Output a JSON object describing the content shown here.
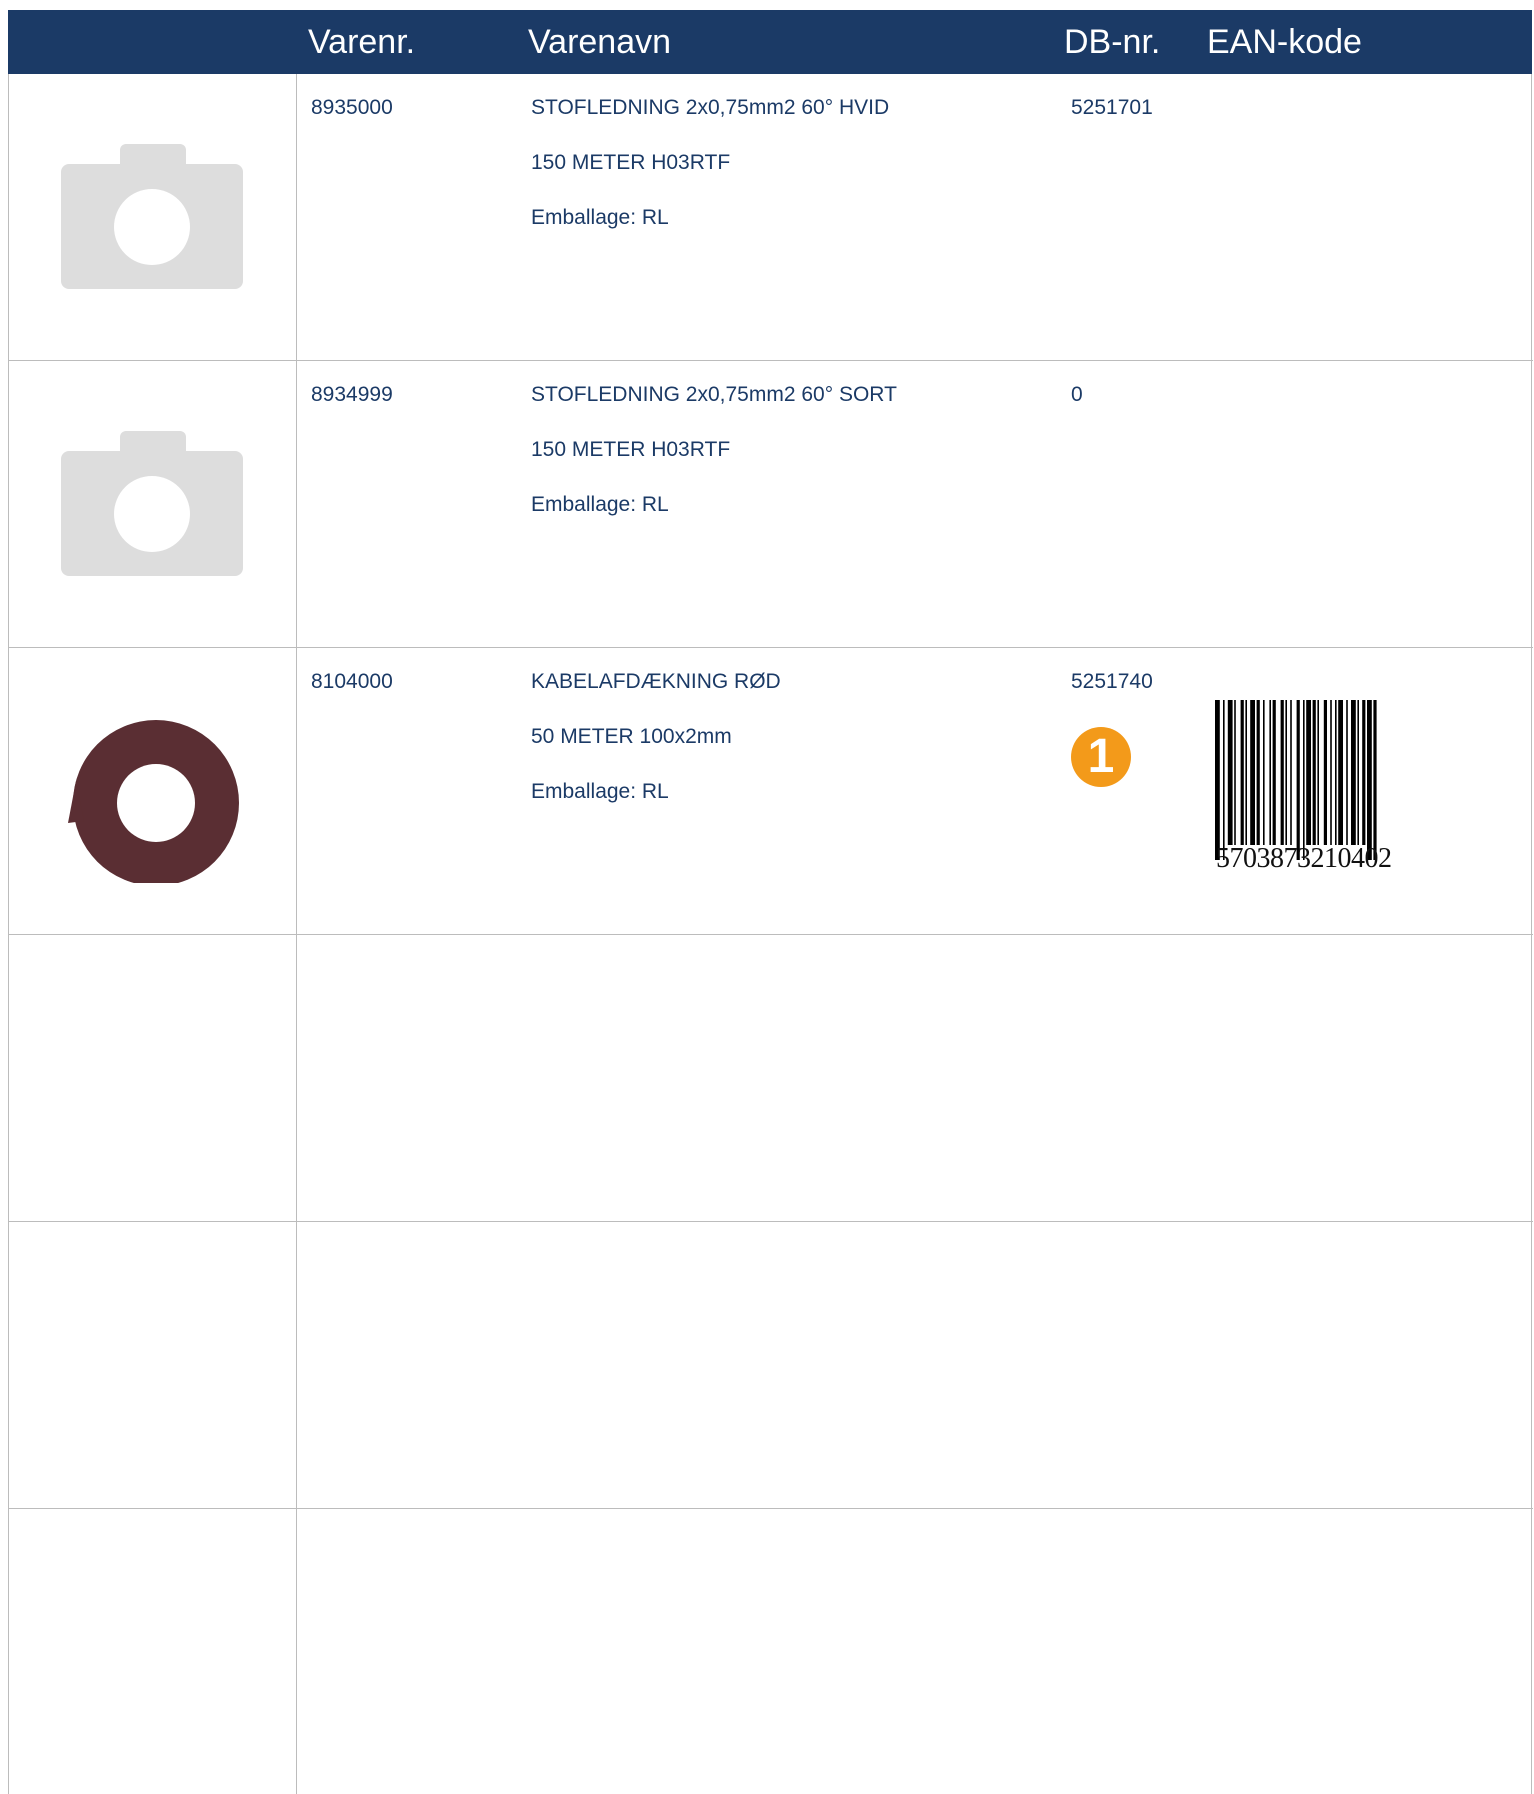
{
  "header": {
    "varenr": "Varenr.",
    "varenavn": "Varenavn",
    "dbnr": "DB-nr.",
    "ean": "EAN-kode"
  },
  "products": [
    {
      "varenr": "8935000",
      "name_line1": "STOFLEDNING 2x0,75mm2 60° HVID",
      "name_line2": "150 METER H03RTF",
      "packaging": "Emballage: RL",
      "dbnr": "5251701",
      "image": "camera-placeholder-icon"
    },
    {
      "varenr": "8934999",
      "name_line1": "STOFLEDNING 2x0,75mm2 60° SORT",
      "name_line2": "150 METER H03RTF",
      "packaging": "Emballage: RL",
      "dbnr": "0",
      "image": "camera-placeholder-icon"
    },
    {
      "varenr": "8104000",
      "name_line1": "KABELAFDÆKNING RØD",
      "name_line2": "50 METER 100x2mm",
      "packaging": "Emballage: RL",
      "dbnr": "5251740",
      "image": "cable-cover-roll-image",
      "badge": "1",
      "ean": "5703873210402"
    }
  ],
  "colors": {
    "header_bg": "#1b3a66",
    "text": "#1b3a66",
    "grid": "#bcbcbc",
    "badge": "#f39a1a",
    "placeholder": "#dddddd",
    "roll": "#5a2e33"
  }
}
